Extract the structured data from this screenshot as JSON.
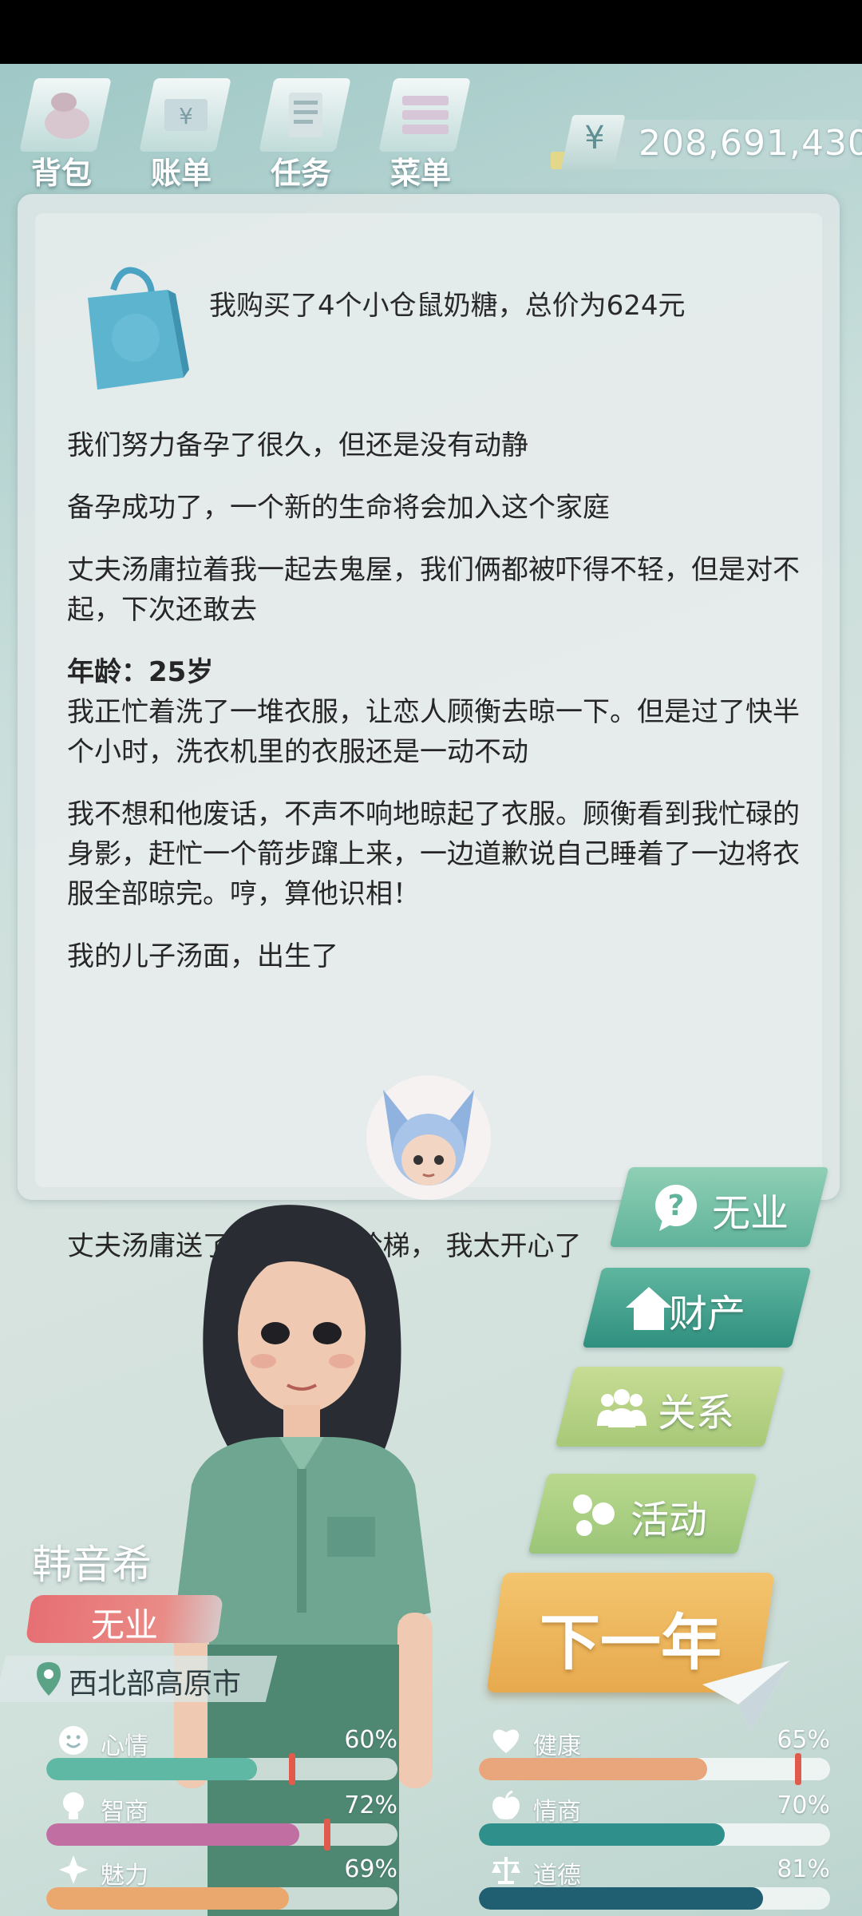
{
  "toolbar": {
    "items": [
      {
        "label": "背包",
        "icon": "backpack-icon"
      },
      {
        "label": "账单",
        "icon": "bill-icon"
      },
      {
        "label": "任务",
        "icon": "task-icon"
      },
      {
        "label": "菜单",
        "icon": "menu-icon"
      }
    ],
    "currency_symbol": "¥",
    "money": "208,691,430"
  },
  "events": {
    "purchase": "我购买了4个小仓鼠奶糖，总价为624元",
    "line1": "我们努力备孕了很久，但还是没有动静",
    "line2": "备孕成功了，一个新的生命将会加入这个家庭",
    "line3": "丈夫汤庸拉着我一起去鬼屋，我们俩都被吓得不轻，但是对不起，下次还敢去",
    "age": "年龄：25岁",
    "line4": "我正忙着洗了一堆衣服，让恋人顾衡去晾一下。但是过了快半个小时，洗衣机里的衣服还是一动不动",
    "line5": "我不想和他废话，不声不响地晾起了衣服。顾衡看到我忙碌的身影，赶忙一个箭步蹿上来，一边道歉说自己睡着了一边将衣服全部晾完。哼，算他识相！",
    "line6": "我的儿子汤面，出生了",
    "line7": "丈夫汤庸送了我1套空中阶梯， 我太开心了"
  },
  "side_menu": {
    "career": "无业",
    "assets": "财产",
    "relations": "关系",
    "activities": "活动",
    "next_year": "下一年"
  },
  "character": {
    "name": "韩音希",
    "job": "无业",
    "location": "西北部高原市"
  },
  "stats": [
    {
      "label": "心情",
      "value": "60%",
      "fraction": 0.6,
      "color": "#5fb8a3",
      "icon": "smile-icon",
      "marker": 0.69
    },
    {
      "label": "健康",
      "value": "65%",
      "fraction": 0.65,
      "color": "#e9a57c",
      "icon": "heart-icon",
      "marker": 0.9
    },
    {
      "label": "智商",
      "value": "72%",
      "fraction": 0.72,
      "color": "#c16ea3",
      "icon": "lightbulb-icon",
      "marker": 0.79
    },
    {
      "label": "情商",
      "value": "70%",
      "fraction": 0.7,
      "color": "#2e8f8b",
      "icon": "apple-icon",
      "marker": null
    },
    {
      "label": "魅力",
      "value": "69%",
      "fraction": 0.69,
      "color": "#eaa86e",
      "icon": "sparkle-icon",
      "marker": null
    },
    {
      "label": "道德",
      "value": "81%",
      "fraction": 0.81,
      "color": "#1f5f71",
      "icon": "scale-icon",
      "marker": null
    }
  ]
}
